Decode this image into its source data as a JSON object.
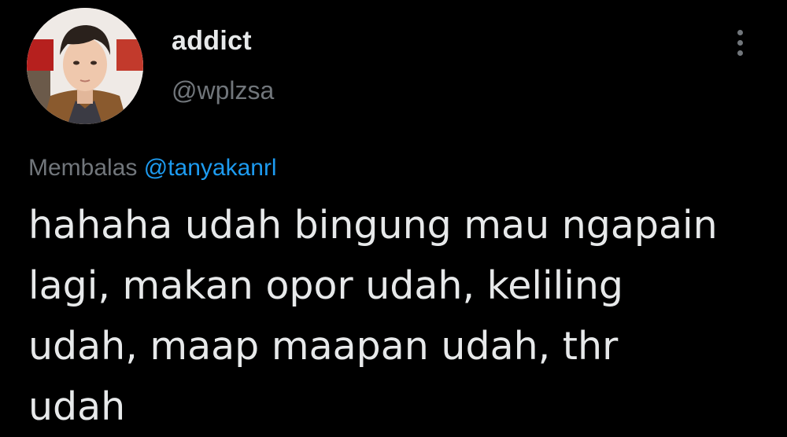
{
  "author": {
    "display_name": "addict",
    "handle": "@wplzsa",
    "avatar_icon": "profile-photo"
  },
  "menu": {
    "icon": "more-vertical-icon"
  },
  "reply": {
    "prefix": "Membalas",
    "mention": "@tanyakanrl"
  },
  "tweet": {
    "lines": [
      "hahaha udah bingung mau ngapain",
      "lagi, makan opor udah, keliling",
      "udah, maap maapan udah, thr",
      "udah"
    ]
  },
  "colors": {
    "background": "#000000",
    "text_primary": "#e7e9ea",
    "text_secondary": "#71767b",
    "link": "#1d9bf0"
  }
}
